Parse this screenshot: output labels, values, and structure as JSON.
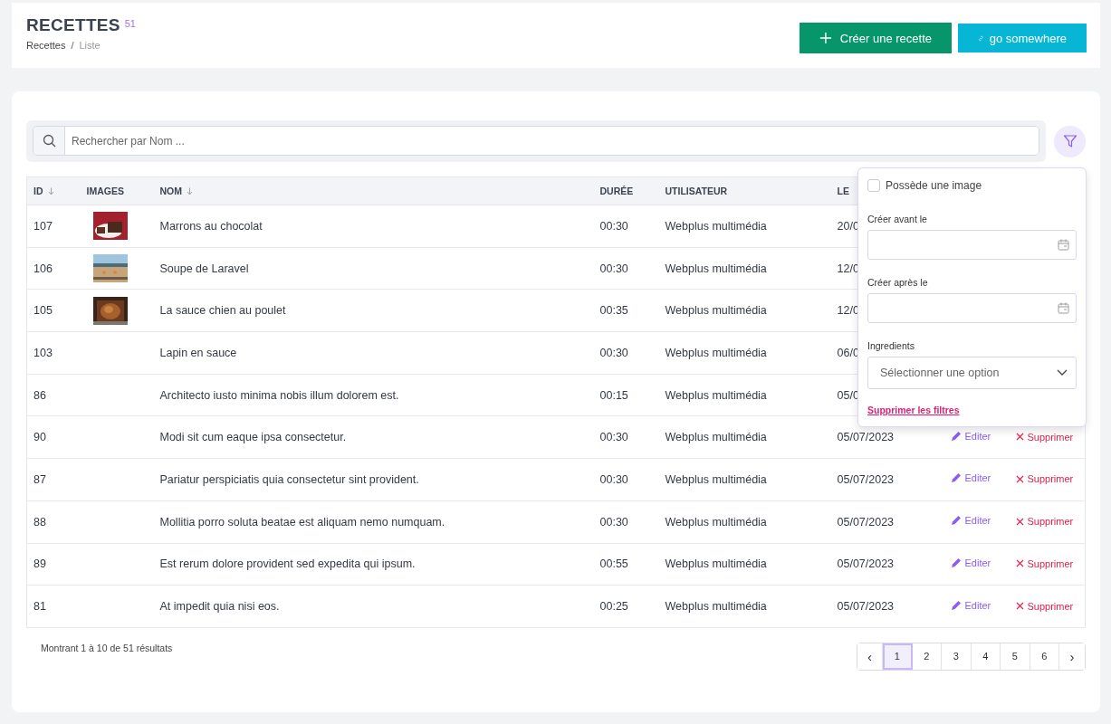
{
  "header": {
    "title": "RECETTES",
    "count": "51",
    "separator": "/",
    "breadcrumb": [
      {
        "label": "Recettes",
        "current": false
      },
      {
        "label": "Liste",
        "current": true
      }
    ],
    "buttons": [
      {
        "kind": "create",
        "label": "Créer une recette"
      },
      {
        "kind": "link",
        "label": "go somewhere"
      }
    ]
  },
  "search": {
    "placeholder": "Rechercher par Nom ..."
  },
  "table": {
    "columns": [
      {
        "label": "ID",
        "sortable": true
      },
      {
        "label": "IMAGES",
        "sortable": false
      },
      {
        "label": "NOM",
        "sortable": true
      },
      {
        "label": "DURÉE",
        "sortable": false
      },
      {
        "label": "UTILISATEUR",
        "sortable": false
      },
      {
        "label": "LE",
        "sortable": false
      }
    ],
    "rows": [
      {
        "id": "107",
        "image": true,
        "name": "Marrons au chocolat",
        "duration": "00:30",
        "user": "Webplus multimédia",
        "date": "20/0"
      },
      {
        "id": "106",
        "image": true,
        "name": "Soupe de Laravel",
        "duration": "00:30",
        "user": "Webplus multimédia",
        "date": "12/0"
      },
      {
        "id": "105",
        "image": true,
        "name": "La sauce chien au poulet",
        "duration": "00:35",
        "user": "Webplus multimédia",
        "date": "12/0"
      },
      {
        "id": "103",
        "image": false,
        "name": "Lapin en sauce",
        "duration": "00:30",
        "user": "Webplus multimédia",
        "date": "06/0"
      },
      {
        "id": "86",
        "image": false,
        "name": "Architecto iusto minima nobis illum dolorem est.",
        "duration": "00:15",
        "user": "Webplus multimédia",
        "date": "05/0"
      },
      {
        "id": "90",
        "image": false,
        "name": "Modi sit cum eaque ipsa consectetur.",
        "duration": "00:30",
        "user": "Webplus multimédia",
        "date": "05/07/2023",
        "edit": "Editer",
        "delete": "Supprimer"
      },
      {
        "id": "87",
        "image": false,
        "name": "Pariatur perspiciatis quia consectetur sint provident.",
        "duration": "00:30",
        "user": "Webplus multimédia",
        "date": "05/07/2023",
        "edit": "Editer",
        "delete": "Supprimer"
      },
      {
        "id": "88",
        "image": false,
        "name": "Mollitia porro soluta beatae est aliquam nemo numquam.",
        "duration": "00:30",
        "user": "Webplus multimédia",
        "date": "05/07/2023",
        "edit": "Editer",
        "delete": "Supprimer"
      },
      {
        "id": "89",
        "image": false,
        "name": "Est rerum dolore provident sed expedita qui ipsum.",
        "duration": "00:55",
        "user": "Webplus multimédia",
        "date": "05/07/2023",
        "edit": "Editer",
        "delete": "Supprimer"
      },
      {
        "id": "81",
        "image": false,
        "name": "At impedit quia nisi eos.",
        "duration": "00:25",
        "user": "Webplus multimédia",
        "date": "05/07/2023",
        "edit": "Editer",
        "delete": "Supprimer"
      }
    ]
  },
  "filters": {
    "checkbox": {
      "label": "Possède une image",
      "checked": false
    },
    "fields": [
      {
        "kind": "date",
        "label": "Créer avant le"
      },
      {
        "kind": "date",
        "label": "Créer après le"
      },
      {
        "kind": "select",
        "label": "Ingredients",
        "placeholder": "Sélectionner une option"
      }
    ],
    "clear": "Supprimer les filtres"
  },
  "footer": {
    "summary": "Montrant 1 à 10 de 51 résultats",
    "prev": "‹",
    "next": "›",
    "pages": [
      {
        "label": "1",
        "selected": true
      },
      {
        "label": "2",
        "selected": false
      },
      {
        "label": "3",
        "selected": false
      },
      {
        "label": "4",
        "selected": false
      },
      {
        "label": "5",
        "selected": false
      },
      {
        "label": "6",
        "selected": false
      }
    ]
  }
}
